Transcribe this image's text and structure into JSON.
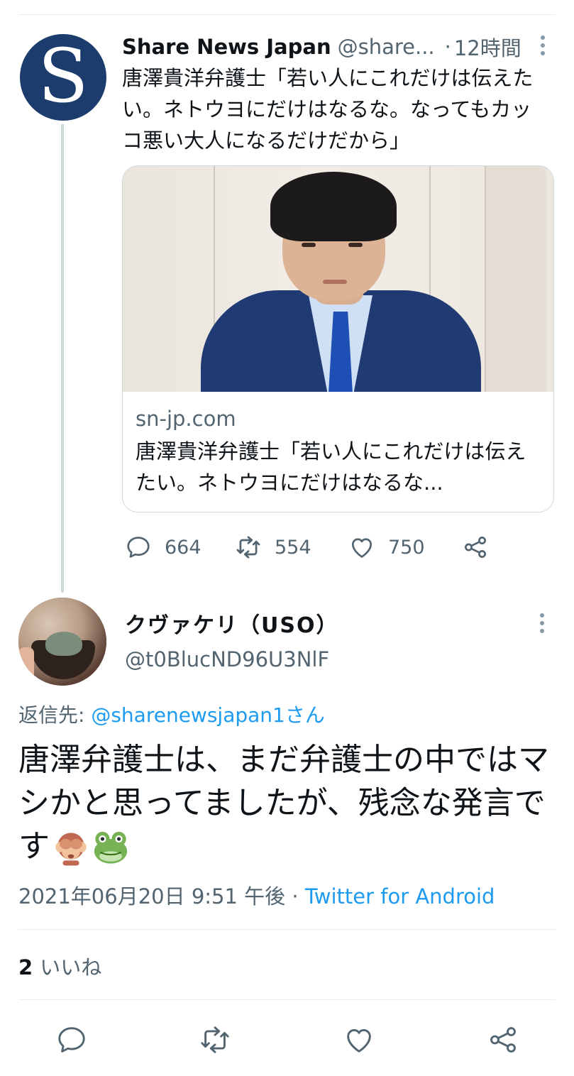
{
  "parent_tweet": {
    "avatar_letter": "S",
    "display_name": "Share News Japan",
    "handle": "@share...",
    "separator": "·",
    "time": "12時間",
    "text": "唐澤貴洋弁護士「若い人にこれだけは伝えたい。ネトウヨにだけはなるな。なってもカッコ悪い大人になるだけだから」",
    "card": {
      "domain": "sn-jp.com",
      "title": "唐澤貴洋弁護士「若い人にこれだけは伝えたい。ネトウヨにだけはなるな..."
    },
    "actions": {
      "reply_icon": "reply-icon",
      "reply_count": "664",
      "retweet_icon": "retweet-icon",
      "retweet_count": "554",
      "like_icon": "heart-icon",
      "like_count": "750",
      "share_icon": "share-icon"
    }
  },
  "focused_tweet": {
    "display_name": "クヴァケリ（USO）",
    "handle": "@t0BlucND96U3NlF",
    "reply_to_prefix": "返信先: ",
    "reply_to_mention": "@sharenewsjapan1さん",
    "text": "唐澤弁護士は、まだ弁護士の中ではマシかと思ってましたが、残念な発言です",
    "emojis": [
      "see-no-evil-monkey",
      "frog-face"
    ],
    "timestamp": "2021年06月20日 9:51 午後 · ",
    "source": "Twitter for Android",
    "like_count": "2",
    "like_label": "いいね"
  },
  "colors": {
    "accent": "#1d9bf0",
    "secondary_text": "#536471",
    "avatar_brand": "#1c3c6e"
  }
}
